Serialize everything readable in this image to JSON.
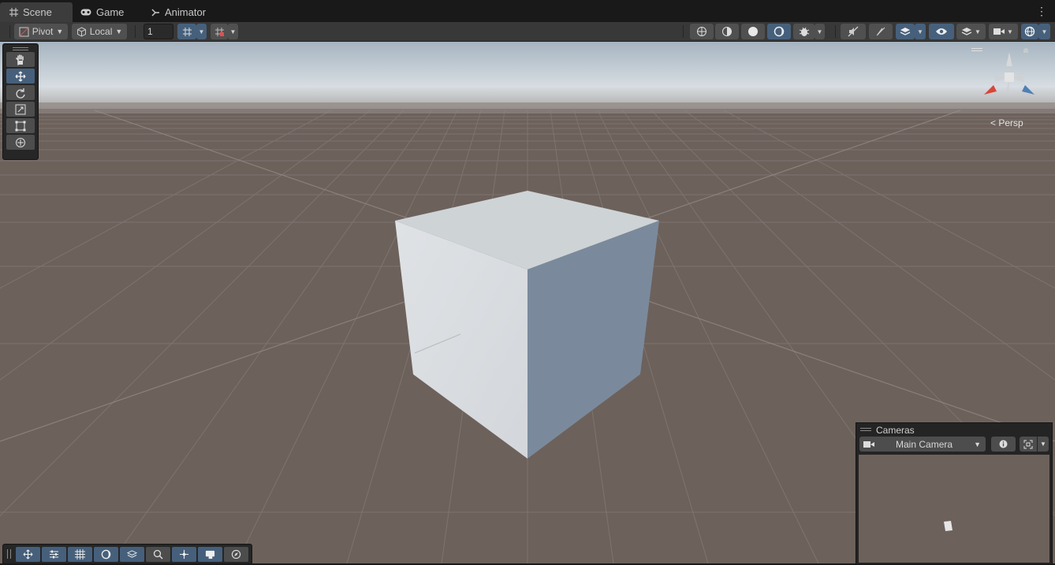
{
  "tabs": [
    {
      "label": "Scene",
      "icon": "grid-icon"
    },
    {
      "label": "Game",
      "icon": "gamepad-icon"
    },
    {
      "label": "Animator",
      "icon": "animator-icon"
    }
  ],
  "toolbar": {
    "pivot_label": "Pivot",
    "local_label": "Local",
    "grid_increment_value": "1"
  },
  "scene_view": {
    "projection_label": "Persp",
    "object": "cube"
  },
  "cameras_overlay": {
    "title": "Cameras",
    "selected_camera": "Main Camera"
  },
  "colors": {
    "accent": "#46607c",
    "ground": "#6d615b",
    "sky_top": "#a8b6c2"
  }
}
